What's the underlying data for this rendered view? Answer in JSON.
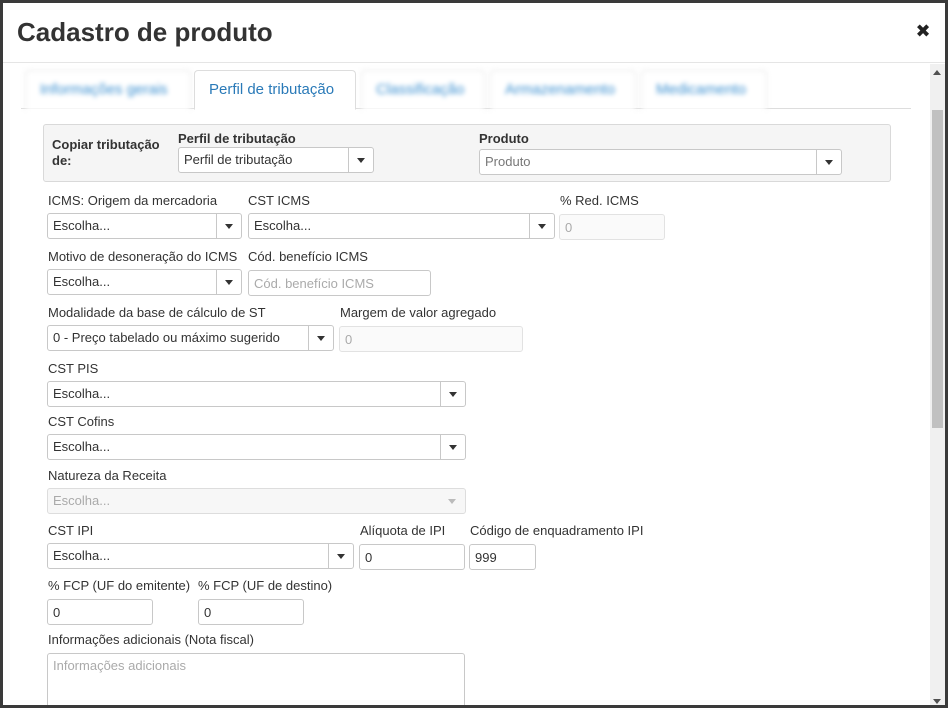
{
  "modal": {
    "title": "Cadastro de produto"
  },
  "tabs": [
    {
      "label": "Informações gerais",
      "active": false
    },
    {
      "label": "Perfil de tributação",
      "active": true
    },
    {
      "label": "Classificação",
      "active": false
    },
    {
      "label": "Armazenamento",
      "active": false
    },
    {
      "label": "Medicamento",
      "active": false
    }
  ],
  "copy": {
    "label": "Copiar tributação de:",
    "label_line1": "Copiar tributação",
    "label_line2": "de:",
    "profile_label": "Perfil de tributação",
    "profile_value": "Perfil de tributação",
    "product_label": "Produto",
    "product_value": "Produto"
  },
  "fields": {
    "icms_origem_label": "ICMS: Origem da mercadoria",
    "icms_origem_value": "Escolha...",
    "cst_icms_label": "CST ICMS",
    "cst_icms_value": "Escolha...",
    "red_icms_label": "% Red. ICMS",
    "red_icms_placeholder": "0",
    "motivo_label": "Motivo de desoneração do ICMS",
    "motivo_value": "Escolha...",
    "beneficio_label": "Cód. benefício ICMS",
    "beneficio_placeholder": "Cód. benefício ICMS",
    "modalidade_label": "Modalidade da base de cálculo de ST",
    "modalidade_value": "0 - Preço tabelado ou máximo sugerido",
    "margem_label": "Margem de valor agregado",
    "margem_placeholder": "0",
    "cst_pis_label": "CST PIS",
    "cst_pis_value": "Escolha...",
    "cst_cofins_label": "CST Cofins",
    "cst_cofins_value": "Escolha...",
    "natureza_label": "Natureza da Receita",
    "natureza_value": "Escolha...",
    "cst_ipi_label": "CST IPI",
    "cst_ipi_value": "Escolha...",
    "aliquota_ipi_label": "Alíquota de IPI",
    "aliquota_ipi_value": "0",
    "enquadramento_label": "Código de enquadramento IPI",
    "enquadramento_value": "999",
    "fcp_emitente_label": "% FCP (UF do emitente)",
    "fcp_emitente_value": "0",
    "fcp_destino_label": "% FCP (UF de destino)",
    "fcp_destino_value": "0",
    "info_label": "Informações adicionais (Nota fiscal)",
    "info_placeholder": "Informações adicionais"
  }
}
